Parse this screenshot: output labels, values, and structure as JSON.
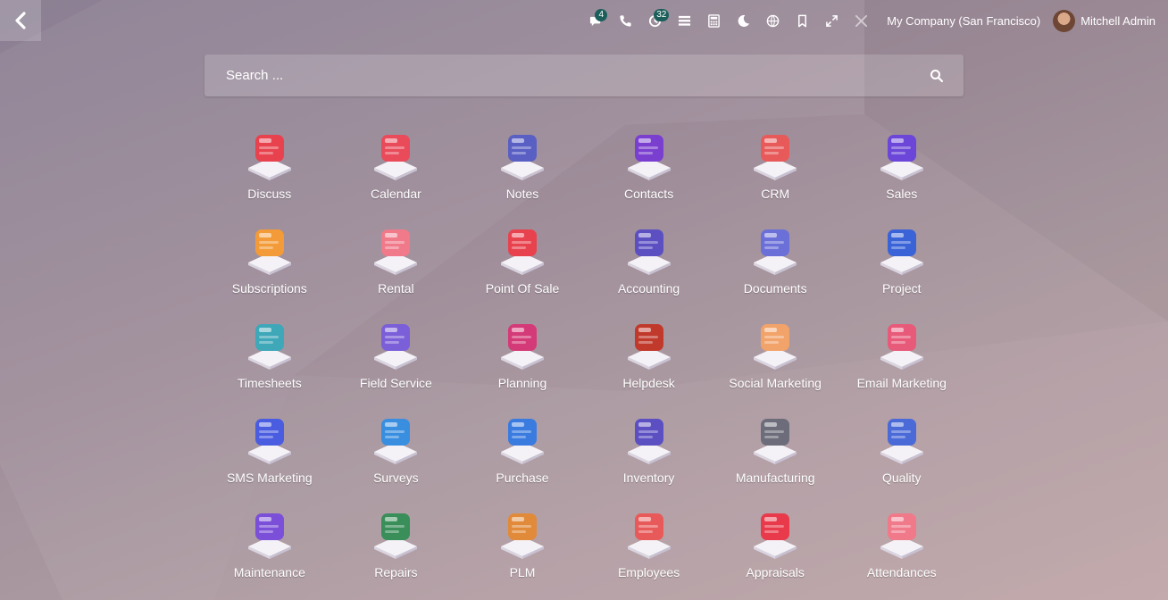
{
  "colors": {
    "badge": "#1c5f5a",
    "background_top": "#8b7f93",
    "background_bottom": "#c1a7a9"
  },
  "topbar": {
    "back_icon": "chevron-left-icon",
    "systray": [
      {
        "name": "messages-icon",
        "badge": "4"
      },
      {
        "name": "phone-icon",
        "badge": ""
      },
      {
        "name": "activity-icon",
        "badge": "32"
      },
      {
        "name": "list-icon",
        "badge": ""
      },
      {
        "name": "calculator-icon",
        "badge": ""
      },
      {
        "name": "moon-icon",
        "badge": ""
      },
      {
        "name": "language-icon",
        "badge": ""
      },
      {
        "name": "bookmark-icon",
        "badge": ""
      },
      {
        "name": "expand-icon",
        "badge": ""
      },
      {
        "name": "tools-icon",
        "badge": ""
      }
    ],
    "company": "My Company (San Francisco)",
    "user_name": "Mitchell Admin"
  },
  "search": {
    "placeholder": "Search ..."
  },
  "apps": [
    {
      "label": "Discuss",
      "icon": "discuss-icon",
      "color": "#e8424e"
    },
    {
      "label": "Calendar",
      "icon": "calendar-icon",
      "color": "#e94b5a"
    },
    {
      "label": "Notes",
      "icon": "notes-icon",
      "color": "#5a5fc4"
    },
    {
      "label": "Contacts",
      "icon": "contacts-icon",
      "color": "#7b3fd0"
    },
    {
      "label": "CRM",
      "icon": "crm-icon",
      "color": "#e85a5a"
    },
    {
      "label": "Sales",
      "icon": "sales-icon",
      "color": "#6b46d8"
    },
    {
      "label": "Subscriptions",
      "icon": "subscriptions-icon",
      "color": "#f39b38"
    },
    {
      "label": "Rental",
      "icon": "rental-icon",
      "color": "#f07a8a"
    },
    {
      "label": "Point Of Sale",
      "icon": "point-of-sale-icon",
      "color": "#e8424e"
    },
    {
      "label": "Accounting",
      "icon": "accounting-icon",
      "color": "#5b4fc2"
    },
    {
      "label": "Documents",
      "icon": "documents-icon",
      "color": "#6b6fd8"
    },
    {
      "label": "Project",
      "icon": "project-icon",
      "color": "#3a63d8"
    },
    {
      "label": "Timesheets",
      "icon": "timesheets-icon",
      "color": "#3ea7b8"
    },
    {
      "label": "Field Service",
      "icon": "field-service-icon",
      "color": "#7b5fd8"
    },
    {
      "label": "Planning",
      "icon": "planning-icon",
      "color": "#d43a78"
    },
    {
      "label": "Helpdesk",
      "icon": "helpdesk-icon",
      "color": "#c0392b"
    },
    {
      "label": "Social Marketing",
      "icon": "social-marketing-icon",
      "color": "#f2a36a"
    },
    {
      "label": "Email Marketing",
      "icon": "email-marketing-icon",
      "color": "#e85a7a"
    },
    {
      "label": "SMS Marketing",
      "icon": "sms-marketing-icon",
      "color": "#4a5de0"
    },
    {
      "label": "Surveys",
      "icon": "surveys-icon",
      "color": "#3a8ee0"
    },
    {
      "label": "Purchase",
      "icon": "purchase-icon",
      "color": "#3a7be0"
    },
    {
      "label": "Inventory",
      "icon": "inventory-icon",
      "color": "#5b4fc2"
    },
    {
      "label": "Manufacturing",
      "icon": "manufacturing-icon",
      "color": "#6c6c7a"
    },
    {
      "label": "Quality",
      "icon": "quality-icon",
      "color": "#4a6ad8"
    },
    {
      "label": "Maintenance",
      "icon": "maintenance-icon",
      "color": "#7b4fd8"
    },
    {
      "label": "Repairs",
      "icon": "repairs-icon",
      "color": "#3a8e5a"
    },
    {
      "label": "PLM",
      "icon": "plm-icon",
      "color": "#e08a3a"
    },
    {
      "label": "Employees",
      "icon": "employees-icon",
      "color": "#e85a5a"
    },
    {
      "label": "Appraisals",
      "icon": "appraisals-icon",
      "color": "#e83a4a"
    },
    {
      "label": "Attendances",
      "icon": "attendances-icon",
      "color": "#f07a8a"
    }
  ]
}
